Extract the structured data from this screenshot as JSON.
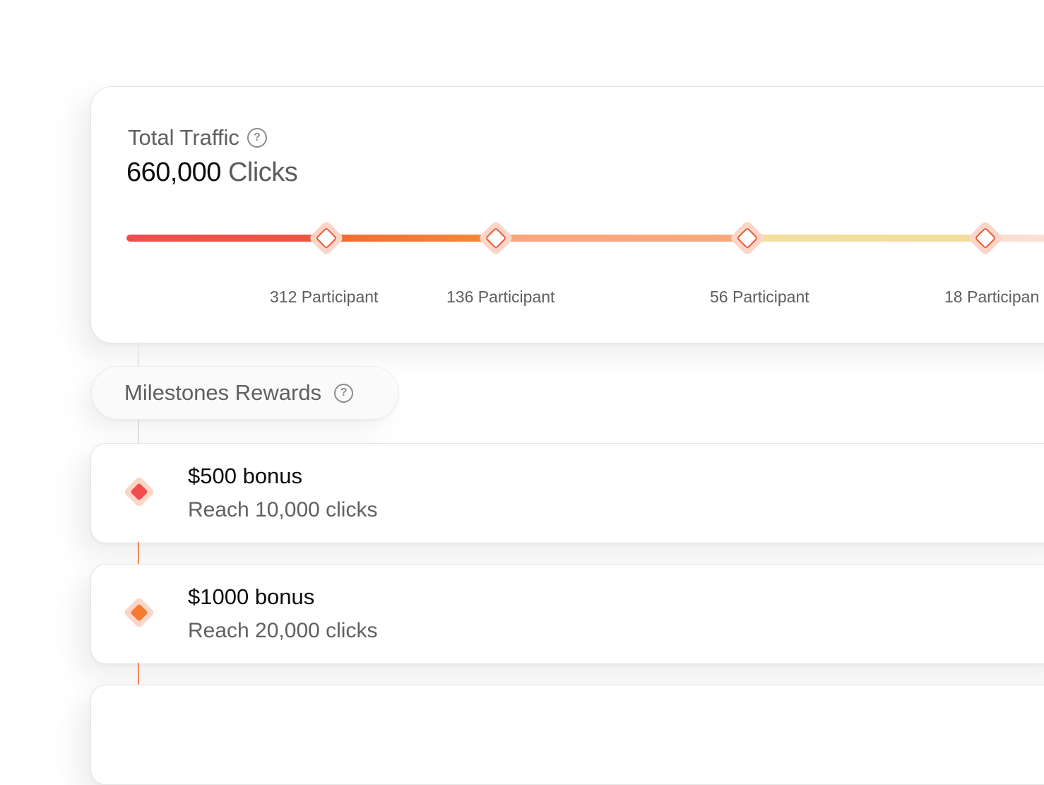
{
  "traffic": {
    "title": "Total Traffic",
    "value": "660,000",
    "unit": "Clicks",
    "help_icon": "question-circle-icon",
    "segments": [
      {
        "color_start": "#f04e4e",
        "color_end": "#f25542"
      },
      {
        "color_start": "#f26a33",
        "color_end": "#f58b3a"
      },
      {
        "color_start": "#f7a57e",
        "color_end": "#f7aa7c"
      },
      {
        "color_start": "#f4dfa0",
        "color_end": "#f3dc9c"
      },
      {
        "color_start": "#fbdcd0",
        "color_end": "#fbe2d8"
      }
    ],
    "markers": [
      {
        "label": "312 Participant"
      },
      {
        "label": "136 Participant"
      },
      {
        "label": "56 Participant"
      },
      {
        "label": "18 Participan"
      }
    ]
  },
  "milestones": {
    "title": "Milestones Rewards",
    "help_icon": "question-circle-icon"
  },
  "rewards": [
    {
      "title": "$500 bonus",
      "subtitle": "Reach 10,000 clicks",
      "color": "#f24c4c",
      "icon": "diamond-icon"
    },
    {
      "title": "$1000 bonus",
      "subtitle": "Reach 20,000 clicks",
      "color": "#f7792f",
      "icon": "diamond-icon"
    }
  ],
  "colors": {
    "accent_red": "#f24c4c",
    "accent_orange": "#f7792f",
    "halo": "#fbd6c8"
  }
}
